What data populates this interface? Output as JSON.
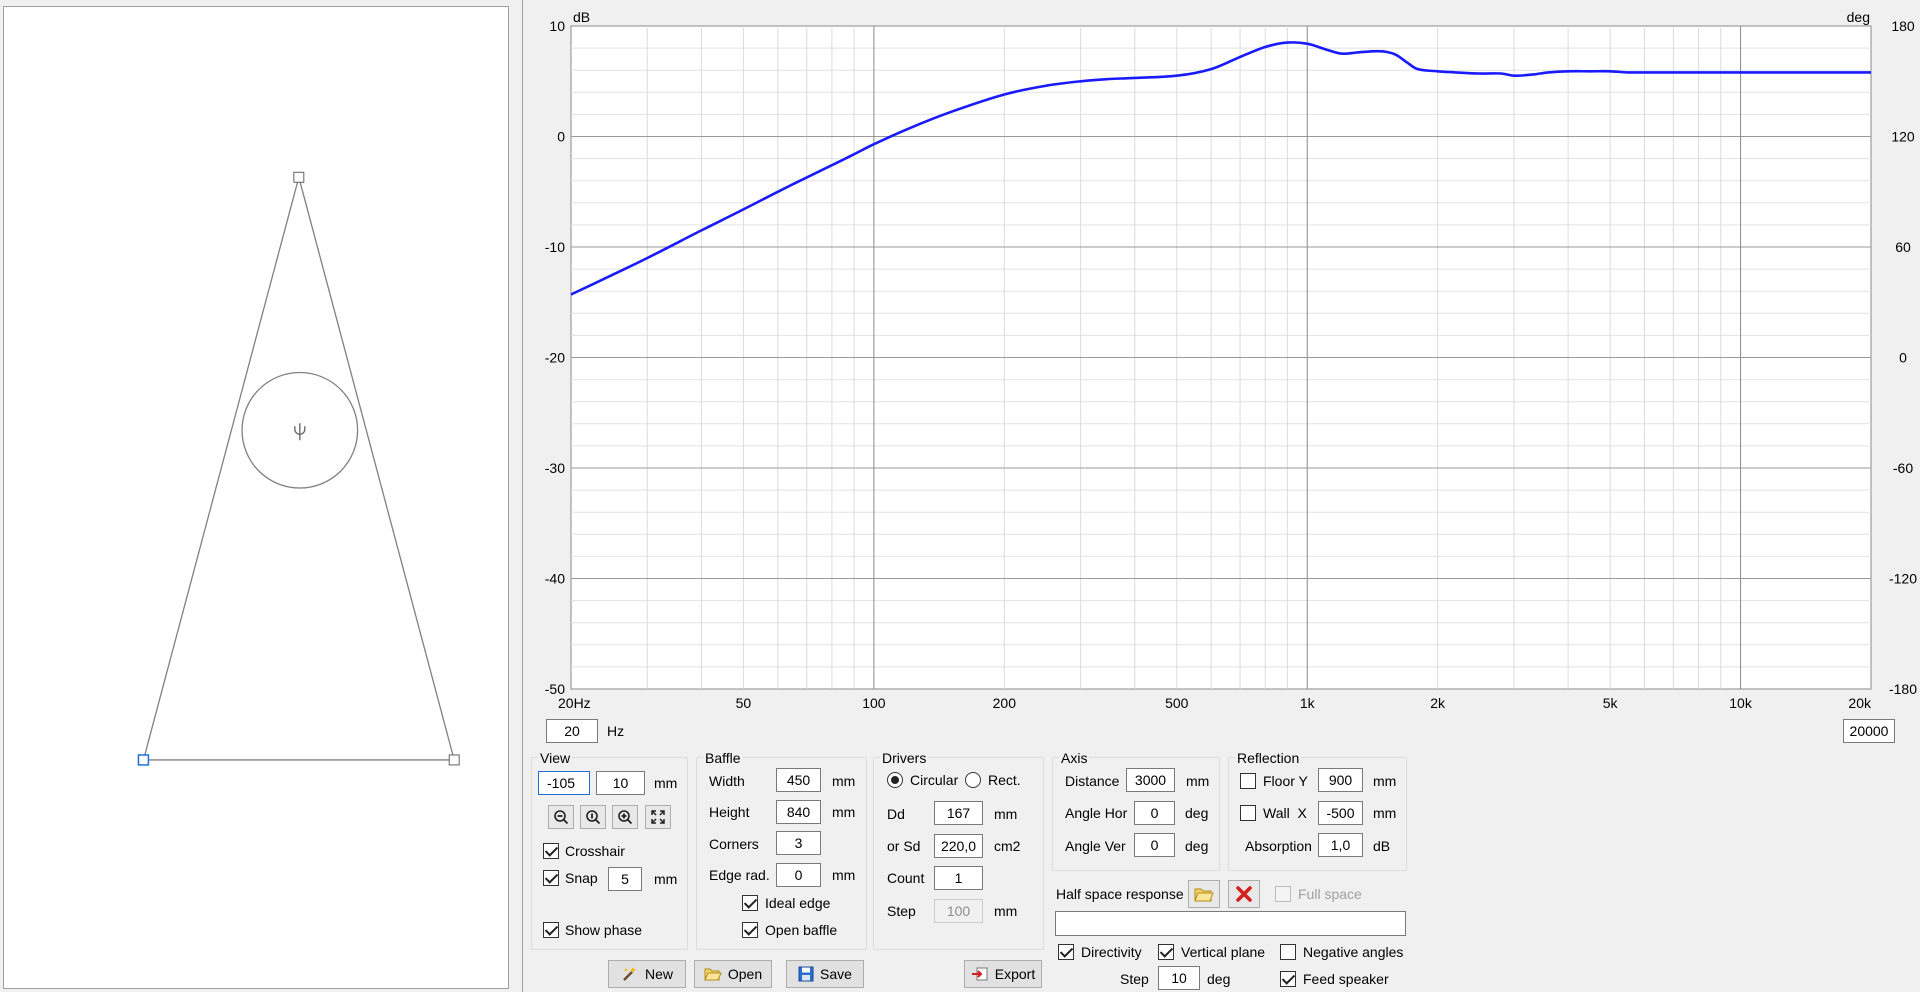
{
  "graph": {
    "y_unit": "dB",
    "y2_unit": "deg",
    "y_ticks": [
      "10",
      "0",
      "-10",
      "-20",
      "-30",
      "-40",
      "-50"
    ],
    "y2_ticks": [
      "180",
      "120",
      "60",
      "0",
      "-60",
      "-120",
      "-180"
    ],
    "x_ticks": [
      "20Hz",
      "50",
      "100",
      "200",
      "500",
      "1k",
      "2k",
      "5k",
      "10k",
      "20k"
    ],
    "x_min": "20",
    "x_unit": "Hz",
    "x_max": "20000",
    "curve_color": "#1a1aff"
  },
  "chart_data": {
    "type": "line",
    "xscale": "log",
    "xlim": [
      20,
      20000
    ],
    "ylim": [
      -50,
      10
    ],
    "y2lim": [
      -180,
      180
    ],
    "ylabel": "dB",
    "y2label": "deg",
    "xlabel": "Hz",
    "grid": true,
    "series": [
      {
        "x": [
          20,
          25,
          30,
          40,
          50,
          60,
          70,
          80,
          90,
          100,
          120,
          150,
          200,
          250,
          300,
          350,
          400,
          500,
          600,
          700,
          800,
          900,
          1000,
          1100,
          1200,
          1300,
          1400,
          1500,
          1600,
          1700,
          1800,
          2000,
          2200,
          2500,
          2800,
          3000,
          3300,
          3600,
          4000,
          4500,
          5000,
          5500,
          6000,
          6500,
          7000,
          8000,
          9000,
          10000,
          12000,
          14000,
          16000,
          18000,
          20000
        ],
        "y": [
          -14.3,
          -12.5,
          -11.0,
          -8.5,
          -6.6,
          -5.0,
          -3.7,
          -2.6,
          -1.6,
          -0.7,
          0.7,
          2.2,
          3.8,
          4.6,
          5.0,
          5.2,
          5.3,
          5.5,
          6.1,
          7.2,
          8.1,
          8.5,
          8.4,
          7.9,
          7.5,
          7.6,
          7.7,
          7.7,
          7.4,
          6.7,
          6.1,
          5.9,
          5.8,
          5.7,
          5.7,
          5.5,
          5.6,
          5.8,
          5.9,
          5.9,
          5.9,
          5.8,
          5.8,
          5.8,
          5.8,
          5.8,
          5.8,
          5.8,
          5.8,
          5.8,
          5.8,
          5.8,
          5.8
        ]
      }
    ]
  },
  "view": {
    "title": "View",
    "x": "-105",
    "y": "10",
    "unit": "mm",
    "crosshair": "Crosshair",
    "snap": "Snap",
    "snap_value": "5",
    "snap_unit": "mm",
    "show_phase": "Show phase"
  },
  "baffle": {
    "title": "Baffle",
    "width_label": "Width",
    "width": "450",
    "height_label": "Height",
    "height": "840",
    "corners_label": "Corners",
    "corners": "3",
    "edge_label": "Edge rad.",
    "edge": "0",
    "unit": "mm",
    "ideal_edge": "Ideal edge",
    "open_baffle": "Open baffle"
  },
  "drivers": {
    "title": "Drivers",
    "circular": "Circular",
    "rect": "Rect.",
    "dd_label": "Dd",
    "dd": "167",
    "dd_unit": "mm",
    "sd_label": "or Sd",
    "sd": "220,0",
    "sd_unit": "cm2",
    "count_label": "Count",
    "count": "1",
    "step_label": "Step",
    "step": "100",
    "step_unit": "mm"
  },
  "axis": {
    "title": "Axis",
    "distance_label": "Distance",
    "distance": "3000",
    "distance_unit": "mm",
    "hor_label": "Angle Hor",
    "hor": "0",
    "ver_label": "Angle Ver",
    "ver": "0",
    "deg": "deg"
  },
  "reflection": {
    "title": "Reflection",
    "floor_label": "Floor Y",
    "floor": "900",
    "wall_label": "Wall  X",
    "wall": "-500",
    "mm": "mm",
    "abs_label": "Absorption",
    "abs": "1,0",
    "abs_unit": "dB"
  },
  "half_space": {
    "label": "Half space response",
    "full_space": "Full space",
    "path": ""
  },
  "directivity": {
    "directivity": "Directivity",
    "vertical": "Vertical plane",
    "negative": "Negative angles",
    "step_label": "Step",
    "step": "10",
    "step_unit": "deg",
    "feed": "Feed speaker"
  },
  "buttons": {
    "new": "New",
    "open": "Open",
    "save": "Save",
    "export": "Export"
  }
}
